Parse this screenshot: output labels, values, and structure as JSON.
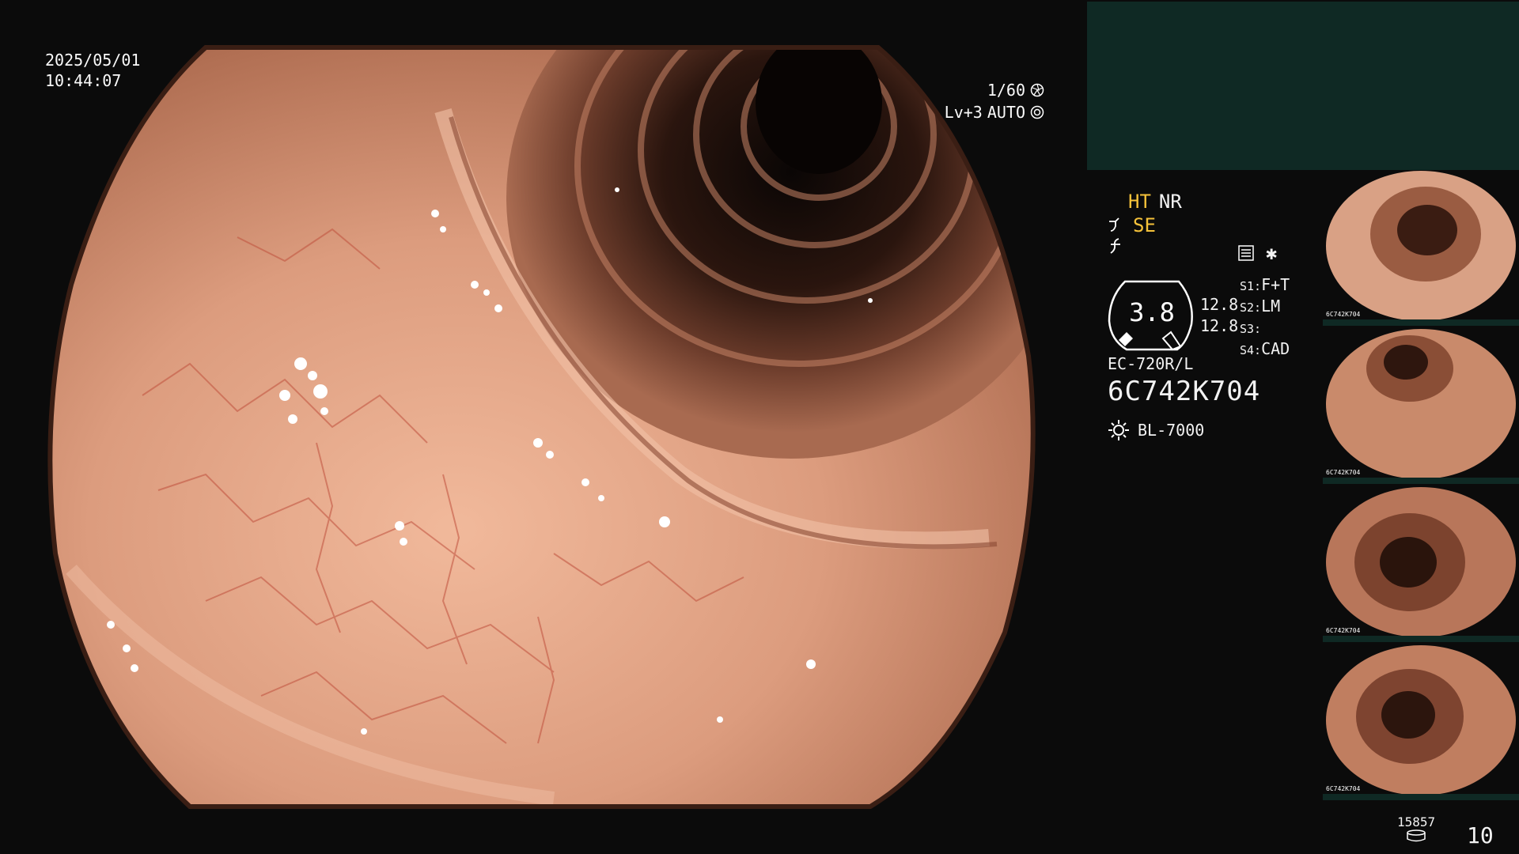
{
  "overlay": {
    "date": "2025/05/01",
    "time": "10:44:07",
    "shutter": "1/60",
    "level": "Lv+3",
    "iris_mode": "AUTO"
  },
  "processing": {
    "ht": "HT",
    "nr": "NR",
    "se": "SE"
  },
  "zoom": {
    "value": "3.8",
    "upper": "12.8",
    "lower": "12.8"
  },
  "switches": [
    {
      "key": "S1:",
      "value": "F+T"
    },
    {
      "key": "S2:",
      "value": "LM"
    },
    {
      "key": "S3:",
      "value": ""
    },
    {
      "key": "S4:",
      "value": "CAD"
    }
  ],
  "scope": {
    "model": "EC-720R/L",
    "serial": "6C742K704"
  },
  "light_source": "BL-7000",
  "thumbnails": [
    {
      "id": "thumb-1",
      "label": "6C742K704"
    },
    {
      "id": "thumb-2",
      "label": "6C742K704"
    },
    {
      "id": "thumb-3",
      "label": "6C742K704"
    },
    {
      "id": "thumb-4",
      "label": "6C742K704"
    }
  ],
  "footer": {
    "image_count": "15857",
    "page_number": "10"
  },
  "colors": {
    "background": "#0b0b0b",
    "preview_panel": "#0f2924",
    "accent_yellow": "#f5c23a",
    "mucosa": "#d99a7c"
  }
}
